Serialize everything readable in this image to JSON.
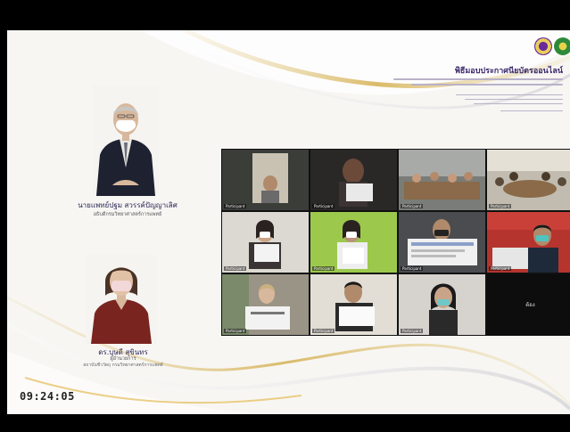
{
  "slide": {
    "event_title": "พิธีมอบประกาศนียบัตรออนไลน์",
    "panelists": [
      {
        "name": "นายแพทย์ปฐม สวรรค์ปัญญาเลิศ",
        "role": "อธิบดีกรมวิทยาศาสตร์การแพทย์"
      },
      {
        "name": "ดร.บุษดี สุขินทร",
        "role": "ผู้อำนวยการ",
        "role_line2": "สถาบันชีววัตถุ กรมวิทยาศาสตร์การแพทย์"
      }
    ],
    "clock": "09:24:05"
  },
  "video_grid": {
    "tiles": [
      {
        "label": "Participant",
        "bg": "#3b3f3a"
      },
      {
        "label": "Participant",
        "bg": "#2c2a28"
      },
      {
        "label": "Participant",
        "bg": "#6b6e6a"
      },
      {
        "label": "Participant",
        "bg": "#b9b3a8"
      },
      {
        "label": "Participant",
        "bg": "#d9d6cf"
      },
      {
        "label": "Participant",
        "bg": "#8fbf3f"
      },
      {
        "label": "Participant",
        "bg": "#4b4d50"
      },
      {
        "label": "Participant",
        "bg": "#b5342e"
      },
      {
        "label": "Participant",
        "bg": "#9a9486"
      },
      {
        "label": "Participant",
        "bg": "#e2ded6"
      },
      {
        "label": "Participant",
        "bg": "#d6d3cf"
      },
      {
        "label": "",
        "bg": "#0d0d0d"
      }
    ],
    "center_name_tile_12": "ต้อง"
  }
}
